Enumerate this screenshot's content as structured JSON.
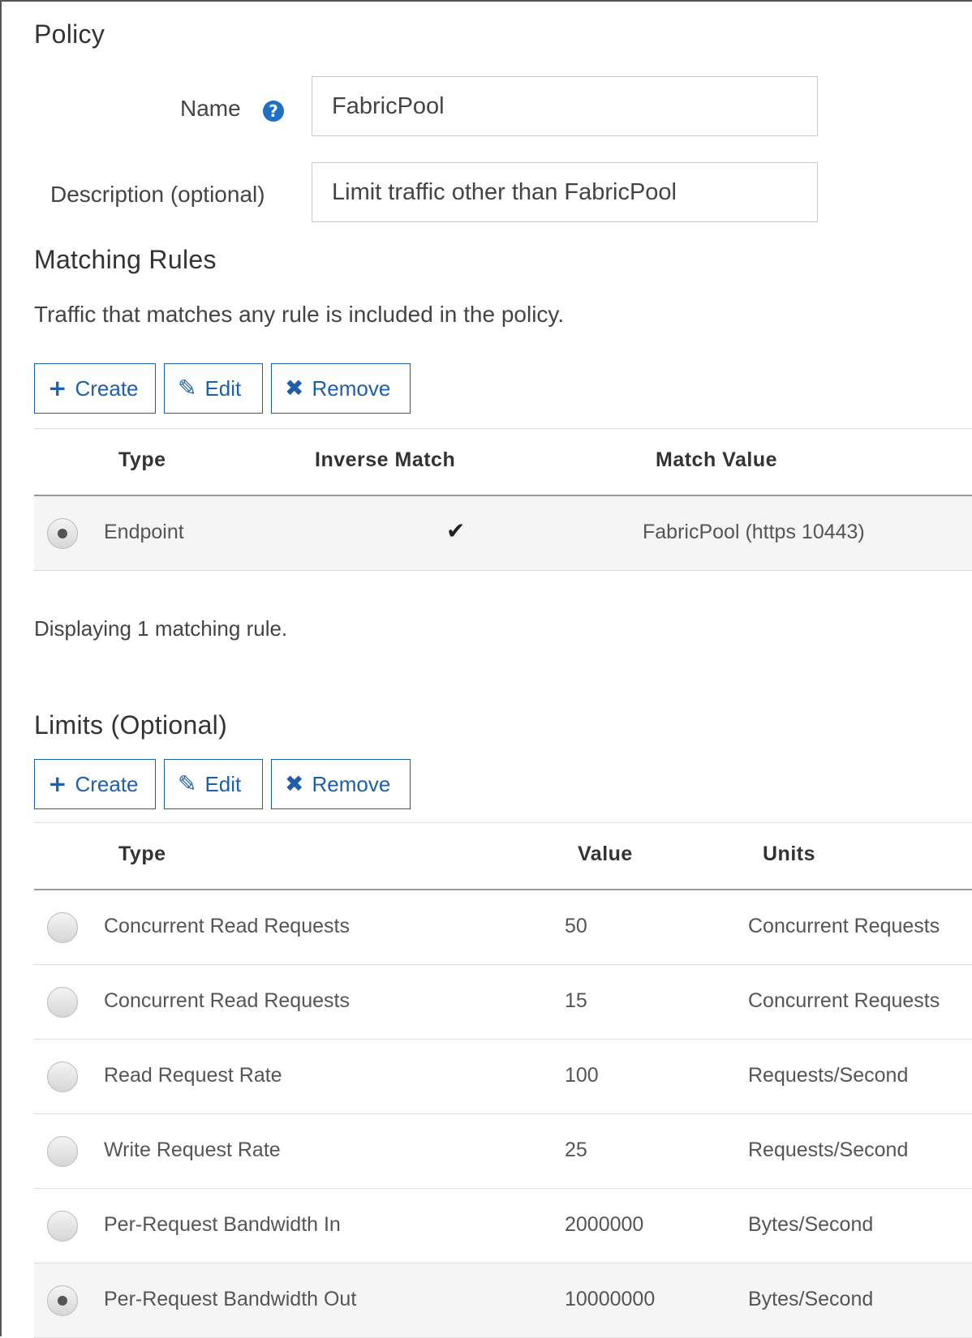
{
  "policy": {
    "heading": "Policy",
    "name_label": "Name",
    "name_value": "FabricPool",
    "description_label": "Description (optional)",
    "description_value": "Limit traffic other than FabricPool"
  },
  "matching_rules": {
    "heading": "Matching Rules",
    "description": "Traffic that matches any rule is included in the policy.",
    "buttons": {
      "create": "Create",
      "edit": "Edit",
      "remove": "Remove"
    },
    "columns": {
      "type": "Type",
      "inverse_match": "Inverse Match",
      "match_value": "Match Value"
    },
    "rows": [
      {
        "type": "Endpoint",
        "inverse_match": true,
        "match_value": "FabricPool (https 10443)",
        "selected": true
      }
    ],
    "footer": "Displaying 1 matching rule."
  },
  "limits": {
    "heading": "Limits (Optional)",
    "buttons": {
      "create": "Create",
      "edit": "Edit",
      "remove": "Remove"
    },
    "columns": {
      "type": "Type",
      "value": "Value",
      "units": "Units"
    },
    "rows": [
      {
        "type": "Concurrent Read Requests",
        "value": "50",
        "units": "Concurrent Requests",
        "selected": false
      },
      {
        "type": "Concurrent Read Requests",
        "value": "15",
        "units": "Concurrent Requests",
        "selected": false
      },
      {
        "type": "Read Request Rate",
        "value": "100",
        "units": "Requests/Second",
        "selected": false
      },
      {
        "type": "Write Request Rate",
        "value": "25",
        "units": "Requests/Second",
        "selected": false
      },
      {
        "type": "Per-Request Bandwidth In",
        "value": "2000000",
        "units": "Bytes/Second",
        "selected": false
      },
      {
        "type": "Per-Request Bandwidth Out",
        "value": "10000000",
        "units": "Bytes/Second",
        "selected": true
      }
    ]
  },
  "icons": {
    "help": "question-circle-icon",
    "create": "plus-icon",
    "edit": "pencil-icon",
    "remove": "times-icon",
    "check": "checkmark-icon"
  },
  "colors": {
    "accent": "#1d5fa8",
    "help_icon": "#1f6fc5",
    "selected_row": "#f5f5f5"
  }
}
